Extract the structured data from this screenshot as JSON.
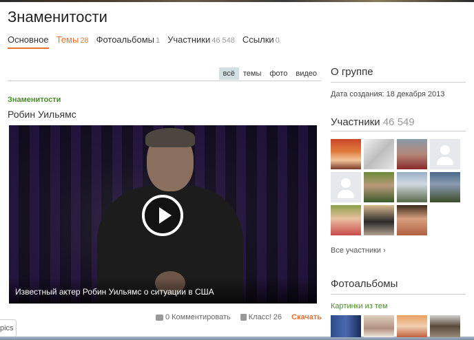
{
  "page": {
    "title": "Знаменитости"
  },
  "tabs": [
    {
      "label": "Основное",
      "count": ""
    },
    {
      "label": "Темы",
      "count": "28"
    },
    {
      "label": "Фотоальбомы",
      "count": "1"
    },
    {
      "label": "Участники",
      "count": "46 548"
    },
    {
      "label": "Ссылки",
      "count": "0"
    }
  ],
  "filters": [
    "всё",
    "темы",
    "фото",
    "видео"
  ],
  "post": {
    "group": "Знаменитости",
    "title": "Робин Уильямс",
    "video_caption": "Известный актер Робин Уильямс о ситуации в США",
    "comment_label": "0 Комментировать",
    "like_label": "Класс! 26",
    "download_label": "Скачать"
  },
  "about": {
    "title": "О группе",
    "created": "Дата создания: 18 декабря 2013"
  },
  "members": {
    "title": "Участники",
    "count": "46 549",
    "all_link": "Все участники ›"
  },
  "photos": {
    "title": "Фотоальбомы",
    "album_link": "Картинки из тем"
  },
  "bottom_tab": {
    "label": "pics"
  },
  "colors": {
    "accent": "#eb722e",
    "group_green": "#4a8c2a",
    "filter_active": "#d4dfe4"
  }
}
